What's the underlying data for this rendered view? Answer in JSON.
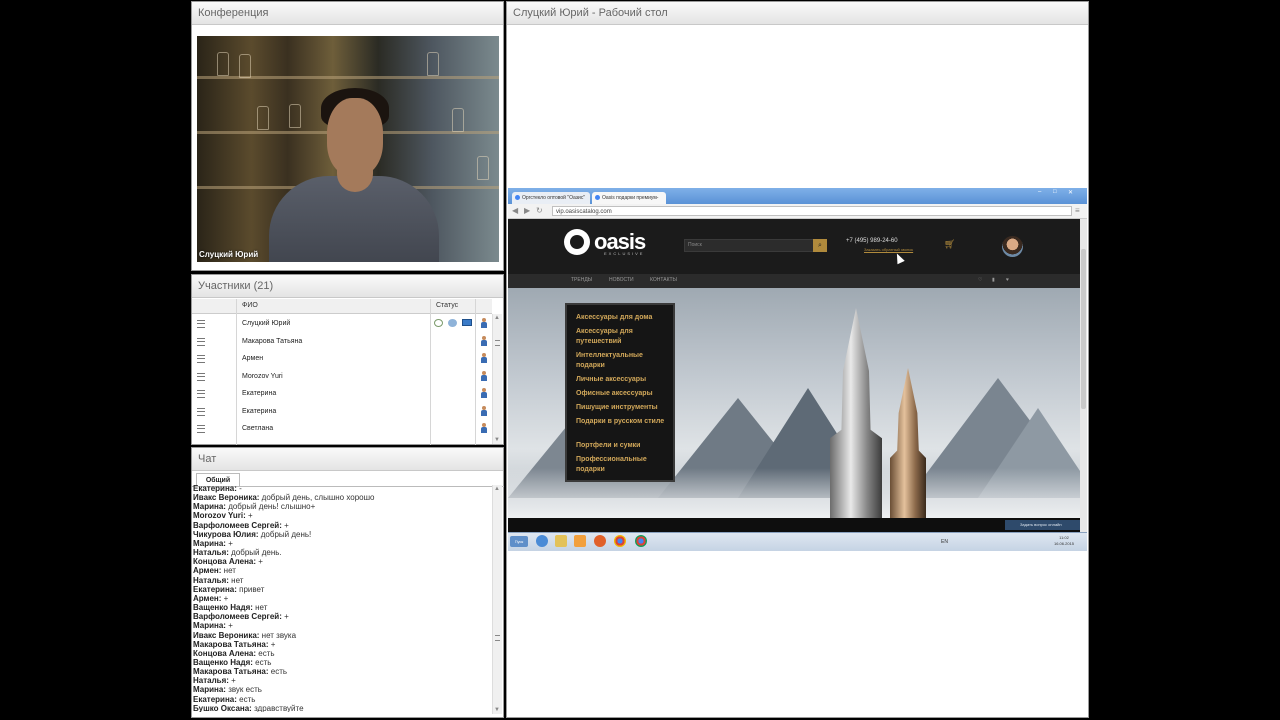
{
  "conference": {
    "title": "Конференция",
    "video_name": "Слуцкий Юрий"
  },
  "participants": {
    "title": "Участники (21)",
    "columns": {
      "name": "ФИО",
      "status": "Статус"
    },
    "rows": [
      "Слуцкий Юрий",
      "Макарова Татьяна",
      "Армен",
      "Morozov Yuri",
      "Екатерина",
      "Екатерина",
      "Светлана"
    ]
  },
  "chat": {
    "title": "Чат",
    "tab": "Общий",
    "messages": [
      {
        "author": "Екатерина:",
        "text": " -"
      },
      {
        "author": "Ивакс Вероника:",
        "text": " добрый день, слышно хорошо"
      },
      {
        "author": "Марина:",
        "text": " добрый день! слышно+"
      },
      {
        "author": "Morozov Yuri:",
        "text": " +"
      },
      {
        "author": "Варфоломеев Сергей:",
        "text": " +"
      },
      {
        "author": "Чикурова Юлия:",
        "text": " добрый день!"
      },
      {
        "author": "Марина:",
        "text": " +"
      },
      {
        "author": "Наталья:",
        "text": " добрый день."
      },
      {
        "author": "Концова Алена:",
        "text": " +"
      },
      {
        "author": "Армен:",
        "text": " нет"
      },
      {
        "author": "Наталья:",
        "text": " нет"
      },
      {
        "author": "Екатерина:",
        "text": " привет"
      },
      {
        "author": "Армен:",
        "text": " +"
      },
      {
        "author": "Ващенко  Надя:",
        "text": " нет"
      },
      {
        "author": "Варфоломеев Сергей:",
        "text": " +"
      },
      {
        "author": "Марина:",
        "text": " +"
      },
      {
        "author": "Ивакс Вероника:",
        "text": " нет звука"
      },
      {
        "author": "Макарова Татьяна:",
        "text": " +"
      },
      {
        "author": "Концова Алена:",
        "text": " есть"
      },
      {
        "author": "Ващенко  Надя:",
        "text": " есть"
      },
      {
        "author": "Макарова Татьяна:",
        "text": " есть"
      },
      {
        "author": "Наталья:",
        "text": " +"
      },
      {
        "author": "Марина:",
        "text": " звук есть"
      },
      {
        "author": "Екатерина:",
        "text": " есть"
      },
      {
        "author": "Бушко Оксана:",
        "text": " здравствуйте"
      }
    ]
  },
  "desktop": {
    "title": "Слуцкий Юрий - Рабочий стол",
    "browser": {
      "tabs": [
        "Оргстекло оптовой \"Оазис\"",
        "Oasis подарки премиум-класса"
      ],
      "url": "vip.oasiscatalog.com"
    },
    "site": {
      "logo": "oasis",
      "logo_sub": "EXCLUSIVE",
      "search_placeholder": "Поиск",
      "phone": "+7 (495) 989-24-60",
      "callback": "Заказать обратный звонок",
      "nav": [
        "ТРЕНДЫ",
        "НОВОСТИ",
        "КОНТАКТЫ"
      ],
      "menu": [
        "Аксессуары для дома",
        "Аксессуары для путешествий",
        "Интеллектуальные подарки",
        "Личные аксессуары",
        "Офисные аксессуары",
        "Пишущие инструменты",
        "Подарки в русском стиле",
        "Портфели и сумки",
        "Профессиональные подарки"
      ],
      "chat_button": "Задать вопрос онлайн"
    },
    "taskbar": {
      "start": "Пуск",
      "lang": "EN",
      "time": "11:02",
      "date": "16.06.2015"
    }
  }
}
